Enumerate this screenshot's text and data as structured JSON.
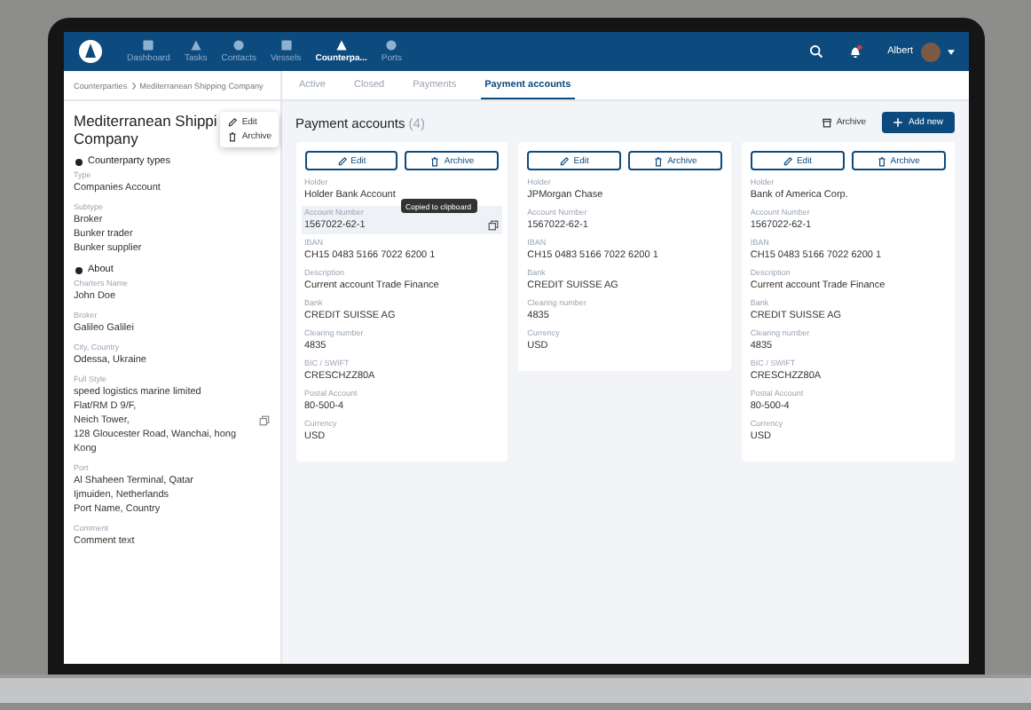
{
  "nav": {
    "items": [
      {
        "label": "Dashboard",
        "selected": false
      },
      {
        "label": "Tasks",
        "selected": false
      },
      {
        "label": "Contacts",
        "selected": false
      },
      {
        "label": "Vessels",
        "selected": false
      },
      {
        "label": "Counterpa...",
        "selected": true
      },
      {
        "label": "Ports",
        "selected": false
      }
    ],
    "notification": true,
    "user": "Albert"
  },
  "sidebar": {
    "breadcrumb": [
      "Counterparties",
      "Mediterranean Shipping Company"
    ],
    "title_lines": [
      "Mediterranean Shippi",
      "Company"
    ],
    "menu": [
      "Edit",
      "Archive"
    ],
    "sections": [
      {
        "title": "Counterparty types",
        "fields": [
          {
            "label": "Type",
            "values": [
              "Companies Account"
            ],
            "copyable": false
          },
          {
            "label": "Subtype",
            "values": [
              "Broker",
              "Bunker trader",
              "Bunker supplier"
            ],
            "copyable": false
          }
        ]
      },
      {
        "title": "About",
        "fields": [
          {
            "label": "Charters Name",
            "values": [
              "John Doe"
            ],
            "copyable": false
          },
          {
            "label": "Broker",
            "values": [
              "Galileo Galilei"
            ],
            "copyable": false
          },
          {
            "label": "City, Country",
            "values": [
              "Odessa, Ukraine"
            ],
            "copyable": false
          },
          {
            "label": "Full Style",
            "values": [
              "speed logistics marine limited",
              "Flat/RM D 9/F,",
              "Neich Tower,",
              "128 Gloucester Road, Wanchai, hong",
              "Kong"
            ],
            "copyable": true
          },
          {
            "label": "Port",
            "values": [
              "Al Shaheen Terminal, Qatar",
              "Ijmuiden, Netherlands",
              "Port Name, Country"
            ],
            "copyable": false
          },
          {
            "label": "Comment",
            "values": [
              "Comment text"
            ],
            "copyable": false
          }
        ]
      }
    ]
  },
  "tabs": [
    {
      "label": "Active",
      "selected": false
    },
    {
      "label": "Closed",
      "selected": false
    },
    {
      "label": "Payments",
      "selected": false
    },
    {
      "label": "Payment accounts",
      "selected": true
    }
  ],
  "accounts": {
    "title": "Payment accounts",
    "count": "(4)",
    "archive_button": "Archive",
    "add_button": "Add new",
    "cards": [
      {
        "buttons": [
          "Edit",
          "Archive"
        ],
        "fields": [
          {
            "label": "Holder",
            "value": "Holder Bank Account",
            "highlighted": false
          },
          {
            "label": "Account Number",
            "value": "1567022-62-1",
            "highlighted": true,
            "tooltip": "Copied to clipboard"
          },
          {
            "label": "IBAN",
            "value": "CH15 0483 5166 7022 6200 1",
            "highlighted": false
          },
          {
            "label": "Description",
            "value": "Current account Trade Finance",
            "highlighted": false
          },
          {
            "label": "Bank",
            "value": "CREDIT SUISSE AG",
            "highlighted": false
          },
          {
            "label": "Clearing number",
            "value": "4835",
            "highlighted": false
          },
          {
            "label": "BIC / SWIFT",
            "value": "CRESCHZZ80A",
            "highlighted": false
          },
          {
            "label": "Postal Account",
            "value": "80-500-4",
            "highlighted": false
          },
          {
            "label": "Currency",
            "value": "USD",
            "highlighted": false
          }
        ]
      },
      {
        "buttons": [
          "Edit",
          "Archive"
        ],
        "fields": [
          {
            "label": "Holder",
            "value": "JPMorgan Chase",
            "highlighted": false
          },
          {
            "label": "Account Number",
            "value": "1567022-62-1",
            "highlighted": false
          },
          {
            "label": "IBAN",
            "value": "CH15 0483 5166 7022 6200 1",
            "highlighted": false
          },
          {
            "label": "Bank",
            "value": "CREDIT SUISSE AG",
            "highlighted": false
          },
          {
            "label": "Clearing number",
            "value": "4835",
            "highlighted": false
          },
          {
            "label": "Currency",
            "value": "USD",
            "highlighted": false
          }
        ]
      },
      {
        "buttons": [
          "Edit",
          "Archive"
        ],
        "fields": [
          {
            "label": "Holder",
            "value": "Bank of America Corp.",
            "highlighted": false
          },
          {
            "label": "Account Number",
            "value": "1567022-62-1",
            "highlighted": false
          },
          {
            "label": "IBAN",
            "value": "CH15 0483 5166 7022 6200 1",
            "highlighted": false
          },
          {
            "label": "Description",
            "value": "Current account Trade Finance",
            "highlighted": false
          },
          {
            "label": "Bank",
            "value": "CREDIT SUISSE AG",
            "highlighted": false
          },
          {
            "label": "Clearing number",
            "value": "4835",
            "highlighted": false
          },
          {
            "label": "BIC / SWIFT",
            "value": "CRESCHZZ80A",
            "highlighted": false
          },
          {
            "label": "Postal Account",
            "value": "80-500-4",
            "highlighted": false
          },
          {
            "label": "Currency",
            "value": "USD",
            "highlighted": false
          }
        ]
      }
    ]
  }
}
